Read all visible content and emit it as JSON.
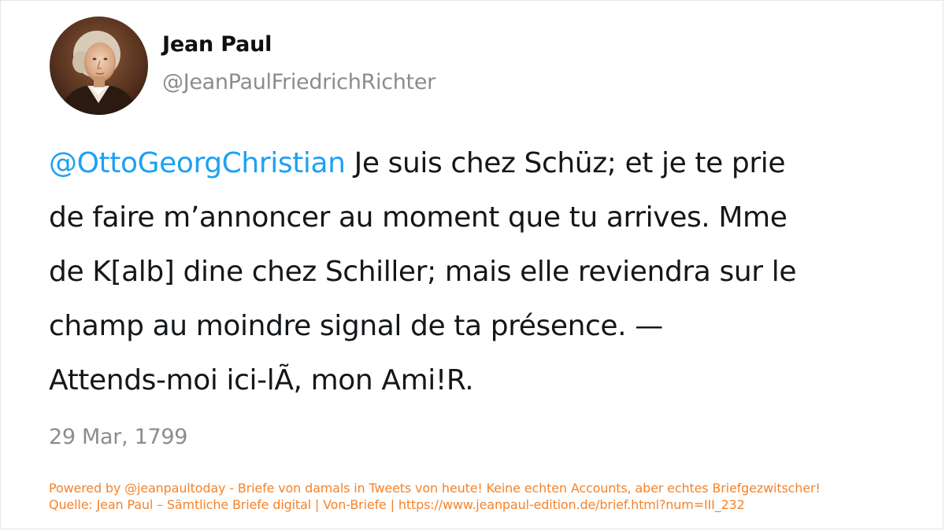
{
  "author": {
    "display_name": "Jean Paul",
    "handle": "@JeanPaulFriedrichRichter",
    "avatar_icon": "portrait-avatar"
  },
  "tweet": {
    "mention": "@OttoGeorgChristian",
    "text": " Je suis chez Schüz; et je te prie\nde faire m’annoncer au moment que tu arrives. Mme\nde K[alb] dine chez Schiller; mais elle reviendra sur le\nchamp au moindre signal de ta présence. —\nAttends-moi ici-lÃ, mon Ami!R.",
    "date": "29 Mar, 1799"
  },
  "footer": {
    "line1": "Powered by @jeanpaultoday - Briefe von damals in Tweets von heute! Keine echten Accounts, aber echtes Briefgezwitscher!",
    "line2": "Quelle: Jean Paul – Sämtliche Briefe digital | Von-Briefe | https://www.jeanpaul-edition.de/brief.html?num=III_232"
  },
  "colors": {
    "mention": "#1da1f2",
    "text": "#14171a",
    "muted": "#8c8c8c",
    "footer": "#f5832a"
  }
}
